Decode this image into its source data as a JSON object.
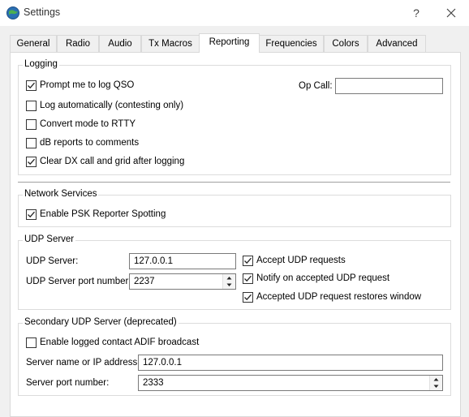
{
  "window": {
    "title": "Settings",
    "help": "?"
  },
  "tabs": [
    {
      "label": "General"
    },
    {
      "label": "Radio"
    },
    {
      "label": "Audio"
    },
    {
      "label": "Tx Macros"
    },
    {
      "label": "Reporting"
    },
    {
      "label": "Frequencies"
    },
    {
      "label": "Colors"
    },
    {
      "label": "Advanced"
    }
  ],
  "active_tab": "Reporting",
  "logging": {
    "title": "Logging",
    "prompt_log_qso": {
      "label": "Prompt me to log QSO",
      "checked": true
    },
    "log_automatically": {
      "label": "Log automatically (contesting only)",
      "checked": false
    },
    "convert_rtty": {
      "label": "Convert mode to RTTY",
      "checked": false
    },
    "db_reports": {
      "label": "dB reports to comments",
      "checked": false
    },
    "clear_dx": {
      "label": "Clear DX call and grid after logging",
      "checked": true
    },
    "op_call_label": "Op Call:",
    "op_call_value": ""
  },
  "network": {
    "title": "Network Services",
    "psk_reporter": {
      "label": "Enable PSK Reporter Spotting",
      "checked": true
    }
  },
  "udp": {
    "title": "UDP Server",
    "server_label": "UDP Server:",
    "server_value": "127.0.0.1",
    "port_label": "UDP Server port number:",
    "port_value": "2237",
    "accept_requests": {
      "label": "Accept UDP requests",
      "checked": true
    },
    "notify_accepted": {
      "label": "Notify on accepted UDP request",
      "checked": true
    },
    "restores_window": {
      "label": "Accepted UDP request restores window",
      "checked": true
    }
  },
  "secondary_udp": {
    "title": "Secondary UDP Server (deprecated)",
    "enable_adif": {
      "label": "Enable logged contact ADIF broadcast",
      "checked": false
    },
    "server_label": "Server name or IP address:",
    "server_value": "127.0.0.1",
    "port_label": "Server port number:",
    "port_value": "2333"
  }
}
